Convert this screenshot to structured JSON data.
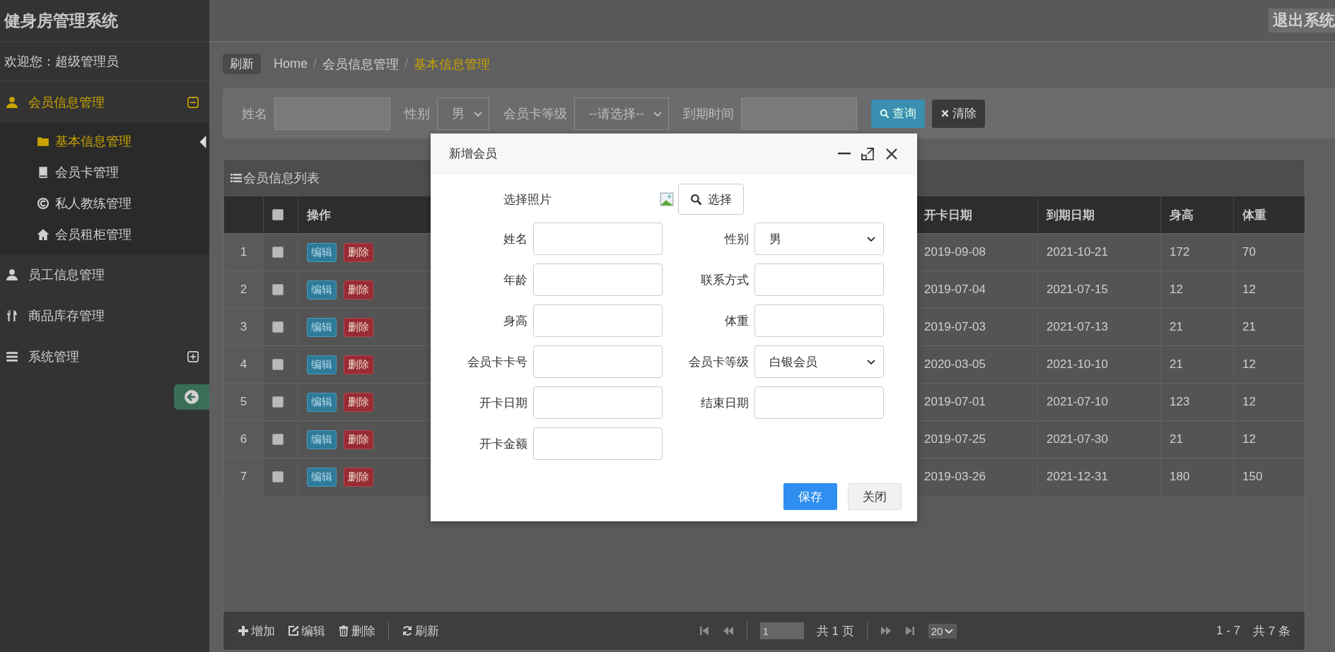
{
  "header": {
    "title": "健身房管理系统",
    "logout": "退出系统"
  },
  "sidebar": {
    "welcome": "欢迎您：超级管理员",
    "menus": [
      {
        "label": "会员信息管理",
        "selected": true,
        "expanded": true,
        "children": [
          {
            "label": "基本信息管理",
            "selected": true
          },
          {
            "label": "会员卡管理",
            "selected": false
          },
          {
            "label": "私人教练管理",
            "selected": false
          },
          {
            "label": "会员租柜管理",
            "selected": false
          }
        ]
      },
      {
        "label": "员工信息管理",
        "selected": false
      },
      {
        "label": "商品库存管理",
        "selected": false
      },
      {
        "label": "系统管理",
        "selected": false,
        "expanded": false
      }
    ]
  },
  "breadcrumb": {
    "refresh": "刷新",
    "separator": "/",
    "items": [
      {
        "label": "Home",
        "selected": false
      },
      {
        "label": "会员信息管理",
        "selected": false
      },
      {
        "label": "基本信息管理",
        "selected": true
      }
    ]
  },
  "search": {
    "fields": [
      {
        "label": "姓名",
        "kind": "text"
      },
      {
        "label": "性别",
        "kind": "select",
        "value": "男"
      },
      {
        "label": "会员卡等级",
        "kind": "select",
        "value": "--请选择--"
      },
      {
        "label": "到期时间",
        "kind": "text"
      }
    ],
    "buttons": [
      {
        "label": "查询",
        "kind": "primary"
      },
      {
        "label": "清除",
        "kind": "dark"
      }
    ]
  },
  "table": {
    "title": "会员信息列表",
    "header_checked": false,
    "action_column": "操作",
    "columns": [
      "开卡日期",
      "到期日期",
      "身高",
      "体重"
    ],
    "rows": [
      {
        "index": "1",
        "checked": false,
        "actions": [
          "编辑",
          "删除"
        ],
        "cells": [
          "2019-09-08",
          "2021-10-21",
          "172",
          "70"
        ]
      },
      {
        "index": "2",
        "checked": false,
        "actions": [
          "编辑",
          "删除"
        ],
        "cells": [
          "2019-07-04",
          "2021-07-15",
          "12",
          "12"
        ]
      },
      {
        "index": "3",
        "checked": false,
        "actions": [
          "编辑",
          "删除"
        ],
        "cells": [
          "2019-07-03",
          "2021-07-13",
          "21",
          "21"
        ]
      },
      {
        "index": "4",
        "checked": false,
        "actions": [
          "编辑",
          "删除"
        ],
        "cells": [
          "2020-03-05",
          "2021-10-10",
          "21",
          "12"
        ]
      },
      {
        "index": "5",
        "checked": false,
        "actions": [
          "编辑",
          "删除"
        ],
        "cells": [
          "2019-07-01",
          "2021-07-10",
          "123",
          "12"
        ]
      },
      {
        "index": "6",
        "checked": false,
        "actions": [
          "编辑",
          "删除"
        ],
        "cells": [
          "2019-07-25",
          "2021-07-30",
          "21",
          "12"
        ]
      },
      {
        "index": "7",
        "checked": false,
        "actions": [
          "编辑",
          "删除"
        ],
        "cells": [
          "2019-03-26",
          "2021-12-31",
          "180",
          "150"
        ]
      }
    ]
  },
  "toolbar": {
    "actions": [
      "增加",
      "编辑",
      "删除",
      "刷新"
    ],
    "page": "1",
    "page_total": "共 1 页",
    "page_size": "20",
    "range": "1 - 7",
    "total": "共 7 条"
  },
  "dialog": {
    "title": "新增会员",
    "photo_label": "选择照片",
    "photo_button": "选择",
    "fields": [
      {
        "label": "姓名",
        "kind": "text"
      },
      {
        "label": "性别",
        "kind": "select",
        "value": "男"
      },
      {
        "label": "年龄",
        "kind": "text"
      },
      {
        "label": "联系方式",
        "kind": "text"
      },
      {
        "label": "身高",
        "kind": "text"
      },
      {
        "label": "体重",
        "kind": "text"
      },
      {
        "label": "会员卡卡号",
        "kind": "text"
      },
      {
        "label": "会员卡等级",
        "kind": "select",
        "value": "白银会员"
      },
      {
        "label": "开卡日期",
        "kind": "text"
      },
      {
        "label": "结束日期",
        "kind": "text"
      },
      {
        "label": "开卡金额",
        "kind": "text"
      }
    ],
    "buttons": [
      {
        "label": "保存",
        "kind": "primary"
      },
      {
        "label": "关闭",
        "kind": "default"
      }
    ]
  }
}
